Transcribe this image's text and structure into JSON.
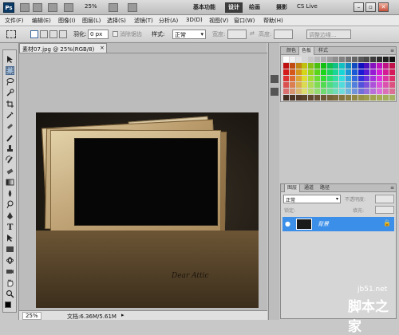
{
  "appbar": {
    "logo": "Ps",
    "zoom": "25%",
    "workspaces": [
      "基本功能",
      "设计",
      "绘画",
      "摄影"
    ],
    "active_workspace": "设计",
    "cs_live": "CS Live"
  },
  "menu": [
    "文件(F)",
    "编辑(E)",
    "图像(I)",
    "图层(L)",
    "选择(S)",
    "滤镜(T)",
    "分析(A)",
    "3D(D)",
    "视图(V)",
    "窗口(W)",
    "帮助(H)"
  ],
  "options": {
    "feather_label": "羽化:",
    "feather_value": "0 px",
    "antialias": "消除锯齿",
    "style_label": "样式:",
    "style_value": "正常",
    "width_label": "宽度:",
    "height_label": "高度:",
    "refine": "调整边缘..."
  },
  "document": {
    "tab": "素材07.jpg @ 25%(RGB/8)",
    "zoom": "25%",
    "doc_info": "文档:6.36M/5.61M"
  },
  "photo": {
    "signature": "Dear Attic"
  },
  "swatch_panel": {
    "tabs": [
      "颜色",
      "色板",
      "样式"
    ],
    "active": "色板"
  },
  "layers_panel": {
    "tabs": [
      "图层",
      "通道",
      "路径"
    ],
    "active": "图层",
    "blend_mode": "正常",
    "opacity_label": "不透明度:",
    "lock_label": "锁定:",
    "fill_label": "填充:",
    "layer_name": "背景"
  },
  "watermark": {
    "site": "jb51.net",
    "text": "脚本之家"
  }
}
